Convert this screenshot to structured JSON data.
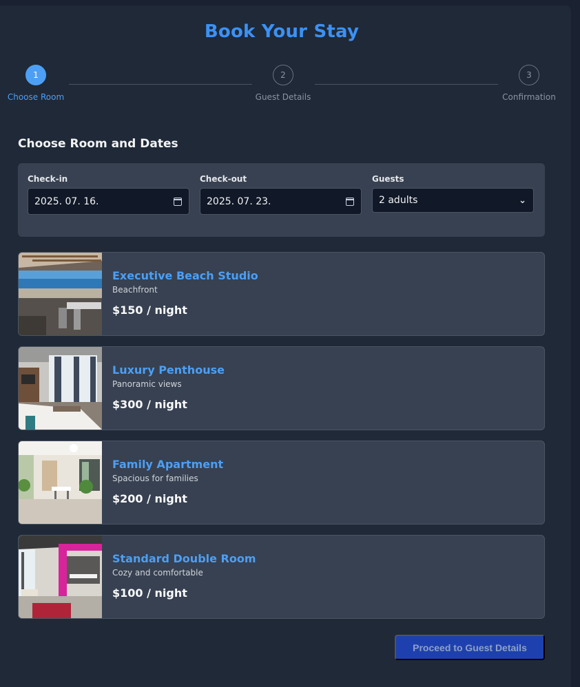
{
  "page": {
    "title": "Book Your Stay"
  },
  "stepper": {
    "steps": [
      {
        "number": "1",
        "label": "Choose Room",
        "state": "active"
      },
      {
        "number": "2",
        "label": "Guest Details",
        "state": "inactive"
      },
      {
        "number": "3",
        "label": "Confirmation",
        "state": "inactive"
      }
    ]
  },
  "section": {
    "title": "Choose Room and Dates"
  },
  "filters": {
    "checkin": {
      "label": "Check-in",
      "value": "2025. 07. 16.",
      "icon": "calendar-icon"
    },
    "checkout": {
      "label": "Check-out",
      "value": "2025. 07. 23.",
      "icon": "calendar-icon"
    },
    "guests": {
      "label": "Guests",
      "value": "2 adults",
      "icon": "chevron-down-icon"
    }
  },
  "rooms": [
    {
      "name": "Executive Beach Studio",
      "description": "Beachfront",
      "price": "$150 / night"
    },
    {
      "name": "Luxury Penthouse",
      "description": "Panoramic views",
      "price": "$300 / night"
    },
    {
      "name": "Family Apartment",
      "description": "Spacious for families",
      "price": "$200 / night"
    },
    {
      "name": "Standard Double Room",
      "description": "Cozy and comfortable",
      "price": "$100 / night"
    }
  ],
  "actions": {
    "proceed_label": "Proceed to Guest Details"
  },
  "colors": {
    "accent": "#4c9ff5",
    "background": "#1f2937",
    "panel": "#374151",
    "button": "#1e40af"
  }
}
